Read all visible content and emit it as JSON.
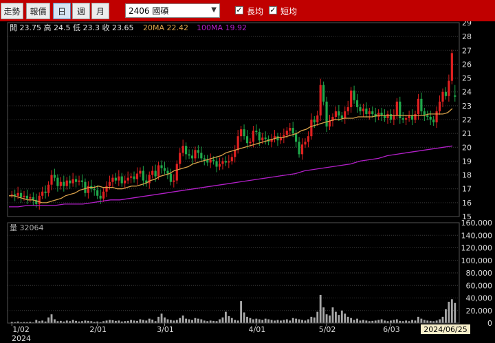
{
  "toolbar": {
    "buttons": [
      "走勢",
      "報價",
      "日",
      "週",
      "月"
    ],
    "active": "日",
    "stock": "2406 國碩",
    "long_ma_label": "長均",
    "short_ma_label": "短均",
    "long_ma_checked": true,
    "short_ma_checked": true
  },
  "colors": {
    "up": "#e02020",
    "down": "#1fa84a",
    "ma20": "#d9a24a",
    "ma100": "#b21fc8",
    "volume": "#a8a8a8",
    "grid": "#3a3a3a",
    "toolbar": "#c00000"
  },
  "price_header": {
    "ohlc": "開 23.75  高 24.5  低 23.3  收 23.65",
    "ma20": "20MA 22.42",
    "ma100": "100MA 19.92"
  },
  "volume_header": "量 32064",
  "x_axis": {
    "year": "2024",
    "months": [
      "1/02",
      "2/01",
      "3/01",
      "4/01",
      "5/02",
      "6/03"
    ],
    "cursor_date": "2024/06/25"
  },
  "chart_data": [
    {
      "type": "candlestick",
      "title": "",
      "ylim": [
        15,
        29
      ],
      "yticks": [
        15,
        16,
        17,
        18,
        19,
        20,
        21,
        22,
        23,
        24,
        25,
        26,
        27,
        28,
        29
      ],
      "start_price": 16.6,
      "closes": [
        16.6,
        16.5,
        16.7,
        16.4,
        16.5,
        16.3,
        16.4,
        16.2,
        15.9,
        16.5,
        16.8,
        16.7,
        17.3,
        18.0,
        17.8,
        17.2,
        17.5,
        17.2,
        17.6,
        17.4,
        17.7,
        17.5,
        17.6,
        17.5,
        16.7,
        17.2,
        17.0,
        16.9,
        16.5,
        16.3,
        16.8,
        17.2,
        17.5,
        17.8,
        17.6,
        17.9,
        17.4,
        17.6,
        17.8,
        17.9,
        17.7,
        18.1,
        18.3,
        17.6,
        17.4,
        18.0,
        18.3,
        17.9,
        18.7,
        18.5,
        18.3,
        18.1,
        17.5,
        17.6,
        18.8,
        19.6,
        20.1,
        19.5,
        19.4,
        19.2,
        19.8,
        19.6,
        19.2,
        19.1,
        18.9,
        19.1,
        19.0,
        18.6,
        18.8,
        19.0,
        18.9,
        19.0,
        19.3,
        19.8,
        20.8,
        21.3,
        20.8,
        20.3,
        20.4,
        21.2,
        21.1,
        20.5,
        20.7,
        20.6,
        20.4,
        20.6,
        20.8,
        20.5,
        20.7,
        20.9,
        21.2,
        21.4,
        21.0,
        20.4,
        19.5,
        20.2,
        20.4,
        20.8,
        22.0,
        21.8,
        22.3,
        24.5,
        23.3,
        21.5,
        21.9,
        22.2,
        22.6,
        22.3,
        22.1,
        22.6,
        22.9,
        24.1,
        23.4,
        22.9,
        22.6,
        22.8,
        22.4,
        22.6,
        22.4,
        22.2,
        22.5,
        22.3,
        22.1,
        22.4,
        22.0,
        22.3,
        23.3,
        22.1,
        22.0,
        22.1,
        22.3,
        22.0,
        22.4,
        23.5,
        22.6,
        22.3,
        22.2,
        22.0,
        21.8,
        22.6,
        23.3,
        24.0,
        23.7,
        24.8,
        26.8,
        23.65
      ],
      "ma20": [
        16.5,
        16.5,
        16.4,
        16.3,
        16.2,
        16.2,
        16.1,
        16.0,
        16.0,
        16.1,
        16.2,
        16.3,
        16.5,
        16.6,
        16.7,
        16.9,
        17.0,
        17.1,
        17.1,
        17.2,
        17.1,
        17.1,
        17.1,
        17.0,
        17.0,
        17.1,
        17.2,
        17.2,
        17.3,
        17.4,
        17.6,
        17.7,
        17.9,
        18.0,
        18.1,
        18.3,
        18.4,
        18.5,
        18.6,
        18.8,
        18.9,
        19.0,
        19.1,
        19.2,
        19.3,
        19.4,
        19.6,
        19.7,
        19.8,
        19.9,
        20.0,
        20.1,
        20.2,
        20.3,
        20.4,
        20.5,
        20.6,
        20.7,
        20.7,
        20.8,
        20.9,
        21.0,
        21.2,
        21.3,
        21.5,
        21.6,
        21.7,
        21.8,
        21.9,
        22.0,
        22.0,
        22.1,
        22.1,
        22.1,
        22.2,
        22.2,
        22.2,
        22.2,
        22.3,
        22.3,
        22.3,
        22.3,
        22.3,
        22.3,
        22.3,
        22.3,
        22.3,
        22.3,
        22.3,
        22.4,
        22.4,
        22.4,
        22.4,
        22.5,
        22.8
      ],
      "ma100": [
        15.7,
        15.7,
        15.8,
        15.8,
        15.8,
        15.8,
        15.9,
        15.9,
        15.9,
        16.0,
        16.1,
        16.2,
        16.2,
        16.3,
        16.4,
        16.5,
        16.6,
        16.7,
        16.8,
        16.9,
        17.0,
        17.1,
        17.2,
        17.3,
        17.4,
        17.5,
        17.6,
        17.7,
        17.8,
        17.9,
        18.0,
        18.1,
        18.3,
        18.4,
        18.5,
        18.6,
        18.7,
        18.8,
        19.0,
        19.1,
        19.2,
        19.4,
        19.5,
        19.6,
        19.7,
        19.8,
        19.9,
        20.0,
        20.1
      ],
      "last_ohlc": {
        "open": 23.75,
        "high": 24.5,
        "low": 23.3,
        "close": 23.65
      }
    },
    {
      "type": "bar",
      "title": "",
      "ylim": [
        0,
        160000
      ],
      "yticks": [
        0,
        20000,
        40000,
        60000,
        80000,
        100000,
        120000,
        140000,
        160000
      ],
      "last_value": 32064,
      "values": [
        2000,
        1500,
        2500,
        1200,
        1800,
        1500,
        2200,
        1000,
        5000,
        3000,
        4000,
        2500,
        9000,
        14000,
        6000,
        3000,
        3500,
        2500,
        4000,
        3000,
        5000,
        3500,
        2500,
        3000,
        4000,
        3500,
        3000,
        2000,
        2500,
        1500,
        3000,
        4000,
        5000,
        4500,
        3500,
        4000,
        2500,
        3000,
        3500,
        5000,
        4000,
        3500,
        6000,
        5000,
        4000,
        7000,
        5500,
        3000,
        10000,
        15000,
        9000,
        6000,
        5000,
        4000,
        5000,
        8000,
        12000,
        7000,
        6000,
        5000,
        8000,
        7000,
        6000,
        4000,
        3000,
        4000,
        3500,
        3000,
        6000,
        9000,
        18000,
        11000,
        8000,
        5000,
        4000,
        35000,
        17000,
        10000,
        8000,
        6000,
        7000,
        6000,
        5000,
        7000,
        6000,
        5000,
        4000,
        5000,
        4000,
        5000,
        6000,
        4000,
        8000,
        7000,
        6000,
        5000,
        4000,
        6000,
        10000,
        9000,
        18000,
        45000,
        25000,
        14000,
        12000,
        25000,
        18000,
        13000,
        20000,
        15000,
        10000,
        8000,
        5000,
        7000,
        4000,
        5000,
        4000,
        3000,
        3500,
        4000,
        5000,
        6000,
        4000,
        3000,
        4000,
        5000,
        6000,
        3500,
        3000,
        4000,
        3000,
        5000,
        4000,
        10000,
        7000,
        5000,
        4000,
        3500,
        3000,
        4000,
        6000,
        10000,
        22000,
        34000,
        38000,
        32064
      ]
    }
  ]
}
